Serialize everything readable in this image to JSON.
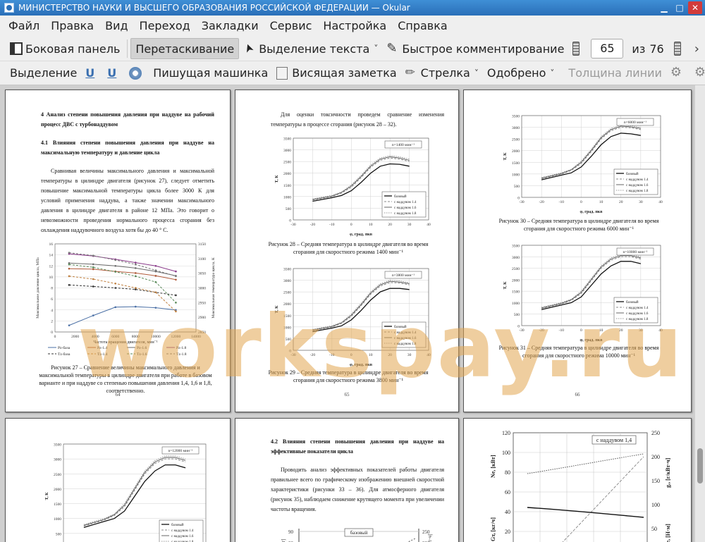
{
  "window": {
    "title": "МИНИСТЕРСТВО НАУКИ И ВЫСШЕГО ОБРАЗОВАНИЯ РОССИЙСКОЙ ФЕДЕРАЦИИ  — Okular"
  },
  "menu": [
    "Файл",
    "Правка",
    "Вид",
    "Переход",
    "Закладки",
    "Сервис",
    "Настройка",
    "Справка"
  ],
  "toolbar": {
    "sidebar": "Боковая панель",
    "drag": "Перетаскивание",
    "text_select": "Выделение текста",
    "quick_comment": "Быстрое комментирование",
    "current_page": "65",
    "of_label": "из",
    "total_pages": "76"
  },
  "annot_toolbar": {
    "highlight": "Выделение",
    "u1": "U",
    "u2": "U",
    "typewriter": "Пишущая машинка",
    "popup_note": "Висящая заметка",
    "arrow": "Стрелка",
    "approved": "Одобрено",
    "line_width": "Толщина линии"
  },
  "watermark": "workspay.ru",
  "pages": {
    "p64": {
      "heading1": "4 Анализ степени повышения давления при наддуве на рабочий процесс ДВС с турбонаддувом",
      "heading2": "4.1 Влияния степени повышения давления при наддуве на максимальную температуру и давление цикла",
      "body": "Сравнивая величины максимального давления и максимальной температуры в цилиндре двигателя (рисунок 27), следует отметить повышение максимальной температуры цикла более 3000 К для условий применения наддува, а также значении максимального давления в цилиндре двигателя в районе 12 МПа. Это говорит о невозможности проведения нормального процесса сгорания без охлаждения наддувочного воздуха хотя бы до 40 ° С.",
      "caption": "Рисунок 27 – Сравнение величины максимального давления и максимальной температуры в цилиндре двигателя при работе в базовом варианте и при наддуве со степенью повышения давления 1,4, 1,6 и 1,8, соответственно.",
      "number": "64"
    },
    "p65": {
      "intro": "Для оценки токсичности проведем сравнение изменения температуры в процессе сгорания (рисунок 28 – 32).",
      "caption28": "Рисунок 28 – Средняя температура в цилиндре двигателя во время сгорания для скоростного режима 1400 мин⁻¹",
      "caption29": "Рисунок 29 – Средняя температура в цилиндре двигателя во время сгорания для скоростного режима 3800 мин⁻¹",
      "number": "65"
    },
    "p66": {
      "caption30": "Рисунок 30 – Средняя температура в цилиндре двигателя во время сгорания для скоростного режима 6000 мин⁻¹",
      "caption31": "Рисунок 31 – Средняя температура в цилиндре двигателя во время сгорания для скоростного режима 10000 мин⁻¹",
      "number": "66"
    },
    "p68": {
      "heading": "4.2 Влияния степени повышения давления при наддуве на эффективные показатели цикла",
      "body": "Проводить анализ эффективных показателей работы двигателя правильнее всего по графическому изображению внешней скоростной характеристики (рисунки 33 – 36). Для атмосферного двигателя (рисунок 35), наблюдаем снижение крутящего момента при увеличении частоты вращения.",
      "chart_box": "базовый"
    },
    "p69": {
      "chart_box": "с наддувом 1,4",
      "y_left": "Ne, [кВт]",
      "y_left2": "Gт, [кг/ч]",
      "y_right": "gₑ, [г/кВт·ч]",
      "y_right2": "Me, [Н·м]"
    }
  },
  "chart_data": [
    {
      "type": "line",
      "id": "fig27",
      "xlabel": "Частота вращения двигателя, мин⁻¹",
      "ylabel": "Максимальное давление цикла, МПа",
      "ylabel_right": "Максимальная температура цикла, К",
      "x": [
        1400,
        3800,
        6000,
        8000,
        10000,
        12000
      ],
      "xlim": [
        0,
        14000
      ],
      "xticks": [
        "0",
        "2000",
        "4000",
        "6000",
        "8000",
        "10000",
        "12000",
        "14000"
      ],
      "ylim": [
        0,
        16
      ],
      "yticks": [
        "0",
        "2",
        "4",
        "6",
        "8",
        "10",
        "12",
        "14",
        "16"
      ],
      "ylim_right": [
        2850,
        3150
      ],
      "yticks_right": [
        "2850",
        "2900",
        "2950",
        "3000",
        "3050",
        "3100",
        "3150"
      ],
      "series": [
        {
          "name": "Pz-база",
          "axis": "left",
          "values": [
            1.2,
            3.0,
            4.5,
            4.6,
            4.4,
            4.0
          ]
        },
        {
          "name": "Pz-1.4",
          "axis": "left",
          "values": [
            11.5,
            11.4,
            11.0,
            10.7,
            10.2,
            9.5
          ]
        },
        {
          "name": "Pz-1.6",
          "axis": "left",
          "values": [
            12.5,
            12.3,
            12.0,
            11.6,
            11.0,
            10.2
          ]
        },
        {
          "name": "Pz-1.8",
          "axis": "left",
          "values": [
            14.2,
            13.8,
            13.2,
            12.6,
            12.0,
            11.0
          ]
        },
        {
          "name": "Tz-база",
          "axis": "right",
          "values": [
            3010,
            3005,
            3000,
            2995,
            2985,
            2975
          ]
        },
        {
          "name": "Tz-1.4",
          "axis": "right",
          "values": [
            3040,
            3030,
            3015,
            3000,
            2985,
            2920
          ]
        },
        {
          "name": "Tz-1.6",
          "axis": "right",
          "values": [
            3080,
            3070,
            3055,
            3040,
            3020,
            2950
          ]
        },
        {
          "name": "Tz-1.8",
          "axis": "right",
          "values": [
            3120,
            3110,
            3095,
            3080,
            3060,
            3040
          ]
        }
      ]
    },
    {
      "type": "line",
      "id": "fig28",
      "box": "n=1400 мин⁻¹",
      "xlabel": "φ, град. пкв",
      "ylabel": "T, К",
      "xlim": [
        -30,
        40
      ],
      "xticks": [
        "-30",
        "-20",
        "-10",
        "0",
        "10",
        "20",
        "30",
        "40"
      ],
      "ylim": [
        0,
        3500
      ],
      "yticks": [
        "0",
        "500",
        "1000",
        "1500",
        "2000",
        "2500",
        "3000",
        "3500"
      ],
      "x": [
        -20,
        -10,
        -5,
        0,
        5,
        10,
        15,
        20,
        25,
        30
      ],
      "series": [
        {
          "name": "базовый",
          "values": [
            800,
            950,
            1050,
            1250,
            1600,
            2000,
            2300,
            2400,
            2380,
            2300
          ]
        },
        {
          "name": "с наддувом 1.4",
          "values": [
            850,
            1000,
            1150,
            1400,
            1800,
            2250,
            2550,
            2650,
            2600,
            2500
          ]
        },
        {
          "name": "с наддувом 1.6",
          "values": [
            870,
            1020,
            1180,
            1450,
            1850,
            2300,
            2600,
            2700,
            2650,
            2550
          ]
        },
        {
          "name": "с наддувом 1.8",
          "values": [
            900,
            1050,
            1200,
            1500,
            1900,
            2350,
            2650,
            2750,
            2700,
            2600
          ]
        }
      ]
    },
    {
      "type": "line",
      "id": "fig29",
      "box": "n=3800 мин⁻¹",
      "xlabel": "φ, град. пкв",
      "ylabel": "T, К",
      "xlim": [
        -30,
        40
      ],
      "xticks": [
        "-30",
        "-20",
        "-10",
        "0",
        "10",
        "20",
        "30",
        "40"
      ],
      "ylim": [
        0,
        3500
      ],
      "yticks": [
        "0",
        "500",
        "1000",
        "1500",
        "2000",
        "2500",
        "3000",
        "3500"
      ],
      "x": [
        -20,
        -10,
        -5,
        0,
        5,
        10,
        15,
        20,
        25,
        30
      ],
      "series": [
        {
          "name": "базовый",
          "values": [
            800,
            950,
            1050,
            1300,
            1700,
            2150,
            2500,
            2650,
            2650,
            2600
          ]
        },
        {
          "name": "с наддувом 1.4",
          "values": [
            850,
            1000,
            1150,
            1450,
            1900,
            2400,
            2750,
            2900,
            2880,
            2800
          ]
        },
        {
          "name": "с наддувом 1.6",
          "values": [
            870,
            1020,
            1180,
            1500,
            1950,
            2450,
            2800,
            2950,
            2920,
            2850
          ]
        },
        {
          "name": "с наддувом 1.8",
          "values": [
            900,
            1050,
            1200,
            1550,
            2000,
            2500,
            2850,
            3000,
            2970,
            2900
          ]
        }
      ]
    },
    {
      "type": "line",
      "id": "fig30",
      "box": "n=6000 мин⁻¹",
      "xlabel": "φ, град. пкв",
      "ylabel": "T, К",
      "xlim": [
        -30,
        40
      ],
      "xticks": [
        "-30",
        "-20",
        "-10",
        "0",
        "10",
        "20",
        "30",
        "40"
      ],
      "ylim": [
        0,
        3500
      ],
      "yticks": [
        "0",
        "500",
        "1000",
        "1500",
        "2000",
        "2500",
        "3000",
        "3500"
      ],
      "x": [
        -20,
        -10,
        -5,
        0,
        5,
        10,
        15,
        20,
        25,
        30
      ],
      "series": [
        {
          "name": "базовый",
          "values": [
            750,
            950,
            1050,
            1300,
            1750,
            2250,
            2600,
            2750,
            2720,
            2650
          ]
        },
        {
          "name": "с наддувом 1.4",
          "values": [
            800,
            1000,
            1150,
            1450,
            1950,
            2500,
            2850,
            3000,
            2980,
            2900
          ]
        },
        {
          "name": "с наддувом 1.6",
          "values": [
            820,
            1020,
            1180,
            1500,
            2000,
            2550,
            2900,
            3050,
            3020,
            2950
          ]
        },
        {
          "name": "с наддувом 1.8",
          "values": [
            850,
            1050,
            1200,
            1550,
            2050,
            2600,
            2950,
            3100,
            3070,
            3000
          ]
        }
      ]
    },
    {
      "type": "line",
      "id": "fig31",
      "box": "n=10000 мин⁻¹",
      "xlabel": "φ, град. пкв",
      "ylabel": "T, К",
      "xlim": [
        -30,
        40
      ],
      "xticks": [
        "-30",
        "-20",
        "-10",
        "0",
        "10",
        "20",
        "30",
        "40"
      ],
      "ylim": [
        0,
        3500
      ],
      "yticks": [
        "0",
        "500",
        "1000",
        "1500",
        "2000",
        "2500",
        "3000",
        "3500"
      ],
      "x": [
        -20,
        -10,
        -5,
        0,
        5,
        10,
        15,
        20,
        25,
        30
      ],
      "series": [
        {
          "name": "базовый",
          "values": [
            700,
            900,
            1000,
            1250,
            1750,
            2250,
            2600,
            2800,
            2800,
            2700
          ]
        },
        {
          "name": "с наддувом 1.4",
          "values": [
            750,
            950,
            1100,
            1400,
            1950,
            2500,
            2850,
            3000,
            3000,
            2900
          ]
        },
        {
          "name": "с наддувом 1.6",
          "values": [
            770,
            970,
            1130,
            1450,
            2000,
            2550,
            2900,
            3050,
            3050,
            2950
          ]
        },
        {
          "name": "с наддувом 1.8",
          "values": [
            800,
            1000,
            1150,
            1500,
            2050,
            2600,
            2950,
            3100,
            3100,
            3000
          ]
        }
      ]
    },
    {
      "type": "line",
      "id": "fig32",
      "box": "n=12000 мин⁻¹",
      "xlabel": "",
      "ylabel": "T, К",
      "xlim": [
        -30,
        40
      ],
      "ylim": [
        0,
        3500
      ],
      "yticks": [
        "0",
        "500",
        "1000",
        "1500",
        "2000",
        "2500",
        "3000",
        "3500"
      ],
      "x": [
        -20,
        -10,
        -5,
        0,
        5,
        10,
        15,
        20,
        25,
        30
      ],
      "series": [
        {
          "name": "базовый",
          "values": [
            700,
            900,
            1000,
            1250,
            1750,
            2250,
            2600,
            2800,
            2800,
            2700
          ]
        },
        {
          "name": "с наддувом 1.4",
          "values": [
            750,
            950,
            1100,
            1400,
            1950,
            2500,
            2850,
            3000,
            3000,
            2900
          ]
        },
        {
          "name": "с наддувом 1.6",
          "values": [
            770,
            970,
            1130,
            1450,
            2000,
            2550,
            2900,
            3050,
            3050,
            2950
          ]
        },
        {
          "name": "с наддувом 1.8",
          "values": [
            800,
            1000,
            1150,
            1500,
            2050,
            2600,
            2950,
            3100,
            3100,
            3000
          ]
        }
      ]
    }
  ]
}
